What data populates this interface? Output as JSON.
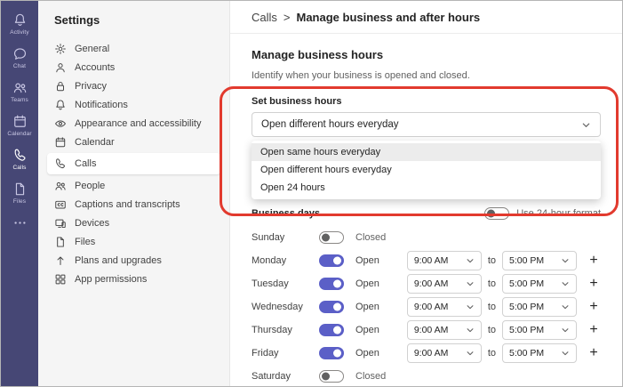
{
  "rail": {
    "items": [
      {
        "id": "activity",
        "label": "Activity",
        "icon": "bell-icon",
        "active": false
      },
      {
        "id": "chat",
        "label": "Chat",
        "icon": "chat-icon",
        "active": false
      },
      {
        "id": "teams",
        "label": "Teams",
        "icon": "people-icon",
        "active": false
      },
      {
        "id": "calendar",
        "label": "Calendar",
        "icon": "calendar-icon",
        "active": false
      },
      {
        "id": "calls",
        "label": "Calls",
        "icon": "phone-icon",
        "active": true
      },
      {
        "id": "files",
        "label": "Files",
        "icon": "file-icon",
        "active": false
      },
      {
        "id": "more",
        "label": "",
        "icon": "more-icon",
        "active": false
      }
    ]
  },
  "sidebar": {
    "title": "Settings",
    "items": [
      {
        "label": "General",
        "icon": "gear-icon",
        "selected": false
      },
      {
        "label": "Accounts",
        "icon": "person-icon",
        "selected": false
      },
      {
        "label": "Privacy",
        "icon": "lock-icon",
        "selected": false
      },
      {
        "label": "Notifications",
        "icon": "bell-icon",
        "selected": false
      },
      {
        "label": "Appearance and accessibility",
        "icon": "eye-icon",
        "selected": false
      },
      {
        "label": "Calendar",
        "icon": "calendar-icon",
        "selected": false
      },
      {
        "label": "Calls",
        "icon": "phone-icon",
        "selected": true
      },
      {
        "label": "People",
        "icon": "people-icon",
        "selected": false
      },
      {
        "label": "Captions and transcripts",
        "icon": "captions-icon",
        "selected": false
      },
      {
        "label": "Devices",
        "icon": "devices-icon",
        "selected": false
      },
      {
        "label": "Files",
        "icon": "file-icon",
        "selected": false
      },
      {
        "label": "Plans and upgrades",
        "icon": "upgrade-icon",
        "selected": false
      },
      {
        "label": "App permissions",
        "icon": "grid-icon",
        "selected": false
      }
    ]
  },
  "breadcrumb": {
    "parent": "Calls",
    "separator": ">",
    "current": "Manage business and after hours"
  },
  "content": {
    "title": "Manage business hours",
    "description": "Identify when your business is opened and closed.",
    "set_hours_label": "Set business hours",
    "select": {
      "value": "Open different hours everyday",
      "options": [
        {
          "label": "Open same hours everyday",
          "highlighted": true
        },
        {
          "label": "Open different hours everyday",
          "highlighted": false
        },
        {
          "label": "Open 24 hours",
          "highlighted": false
        }
      ]
    },
    "business_days_label": "Business days",
    "format_toggle": {
      "label": "Use 24-hour format",
      "on": false
    },
    "to_label": "to",
    "add_label": "+",
    "days": [
      {
        "name": "Sunday",
        "open": false,
        "state": "Closed",
        "start": "",
        "end": ""
      },
      {
        "name": "Monday",
        "open": true,
        "state": "Open",
        "start": "9:00 AM",
        "end": "5:00 PM"
      },
      {
        "name": "Tuesday",
        "open": true,
        "state": "Open",
        "start": "9:00 AM",
        "end": "5:00 PM"
      },
      {
        "name": "Wednesday",
        "open": true,
        "state": "Open",
        "start": "9:00 AM",
        "end": "5:00 PM"
      },
      {
        "name": "Thursday",
        "open": true,
        "state": "Open",
        "start": "9:00 AM",
        "end": "5:00 PM"
      },
      {
        "name": "Friday",
        "open": true,
        "state": "Open",
        "start": "9:00 AM",
        "end": "5:00 PM"
      },
      {
        "name": "Saturday",
        "open": false,
        "state": "Closed",
        "start": "",
        "end": ""
      }
    ]
  },
  "colors": {
    "rail_bg": "#464775",
    "sidebar_bg": "#f5f5f5",
    "accent": "#5b5fc7",
    "annotation": "#e23a2e",
    "option_highlight": "#ececec"
  }
}
